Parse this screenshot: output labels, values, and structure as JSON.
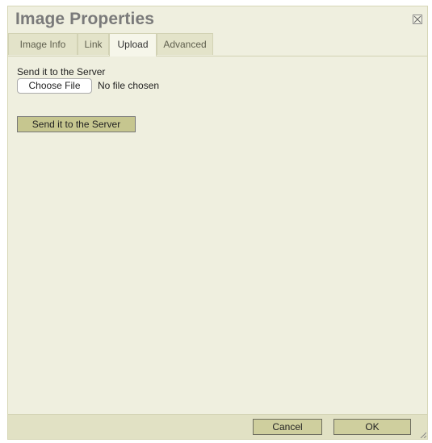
{
  "dialog": {
    "title": "Image Properties"
  },
  "tabs": [
    {
      "label": "Image Info",
      "active": false
    },
    {
      "label": "Link",
      "active": false
    },
    {
      "label": "Upload",
      "active": true
    },
    {
      "label": "Advanced",
      "active": false
    }
  ],
  "upload": {
    "label": "Send it to the Server",
    "choose_file": "Choose File",
    "file_status": "No file chosen",
    "send_button": "Send it to the Server"
  },
  "footer": {
    "cancel": "Cancel",
    "ok": "OK"
  },
  "icons": {
    "close": "close-icon",
    "resize": "resize-grip-icon"
  },
  "colors": {
    "dialog_bg": "#efefdf",
    "tab_bg": "#e3e3c9",
    "footer_bg": "#e1e1c4",
    "button_bg": "#c6c68f"
  }
}
